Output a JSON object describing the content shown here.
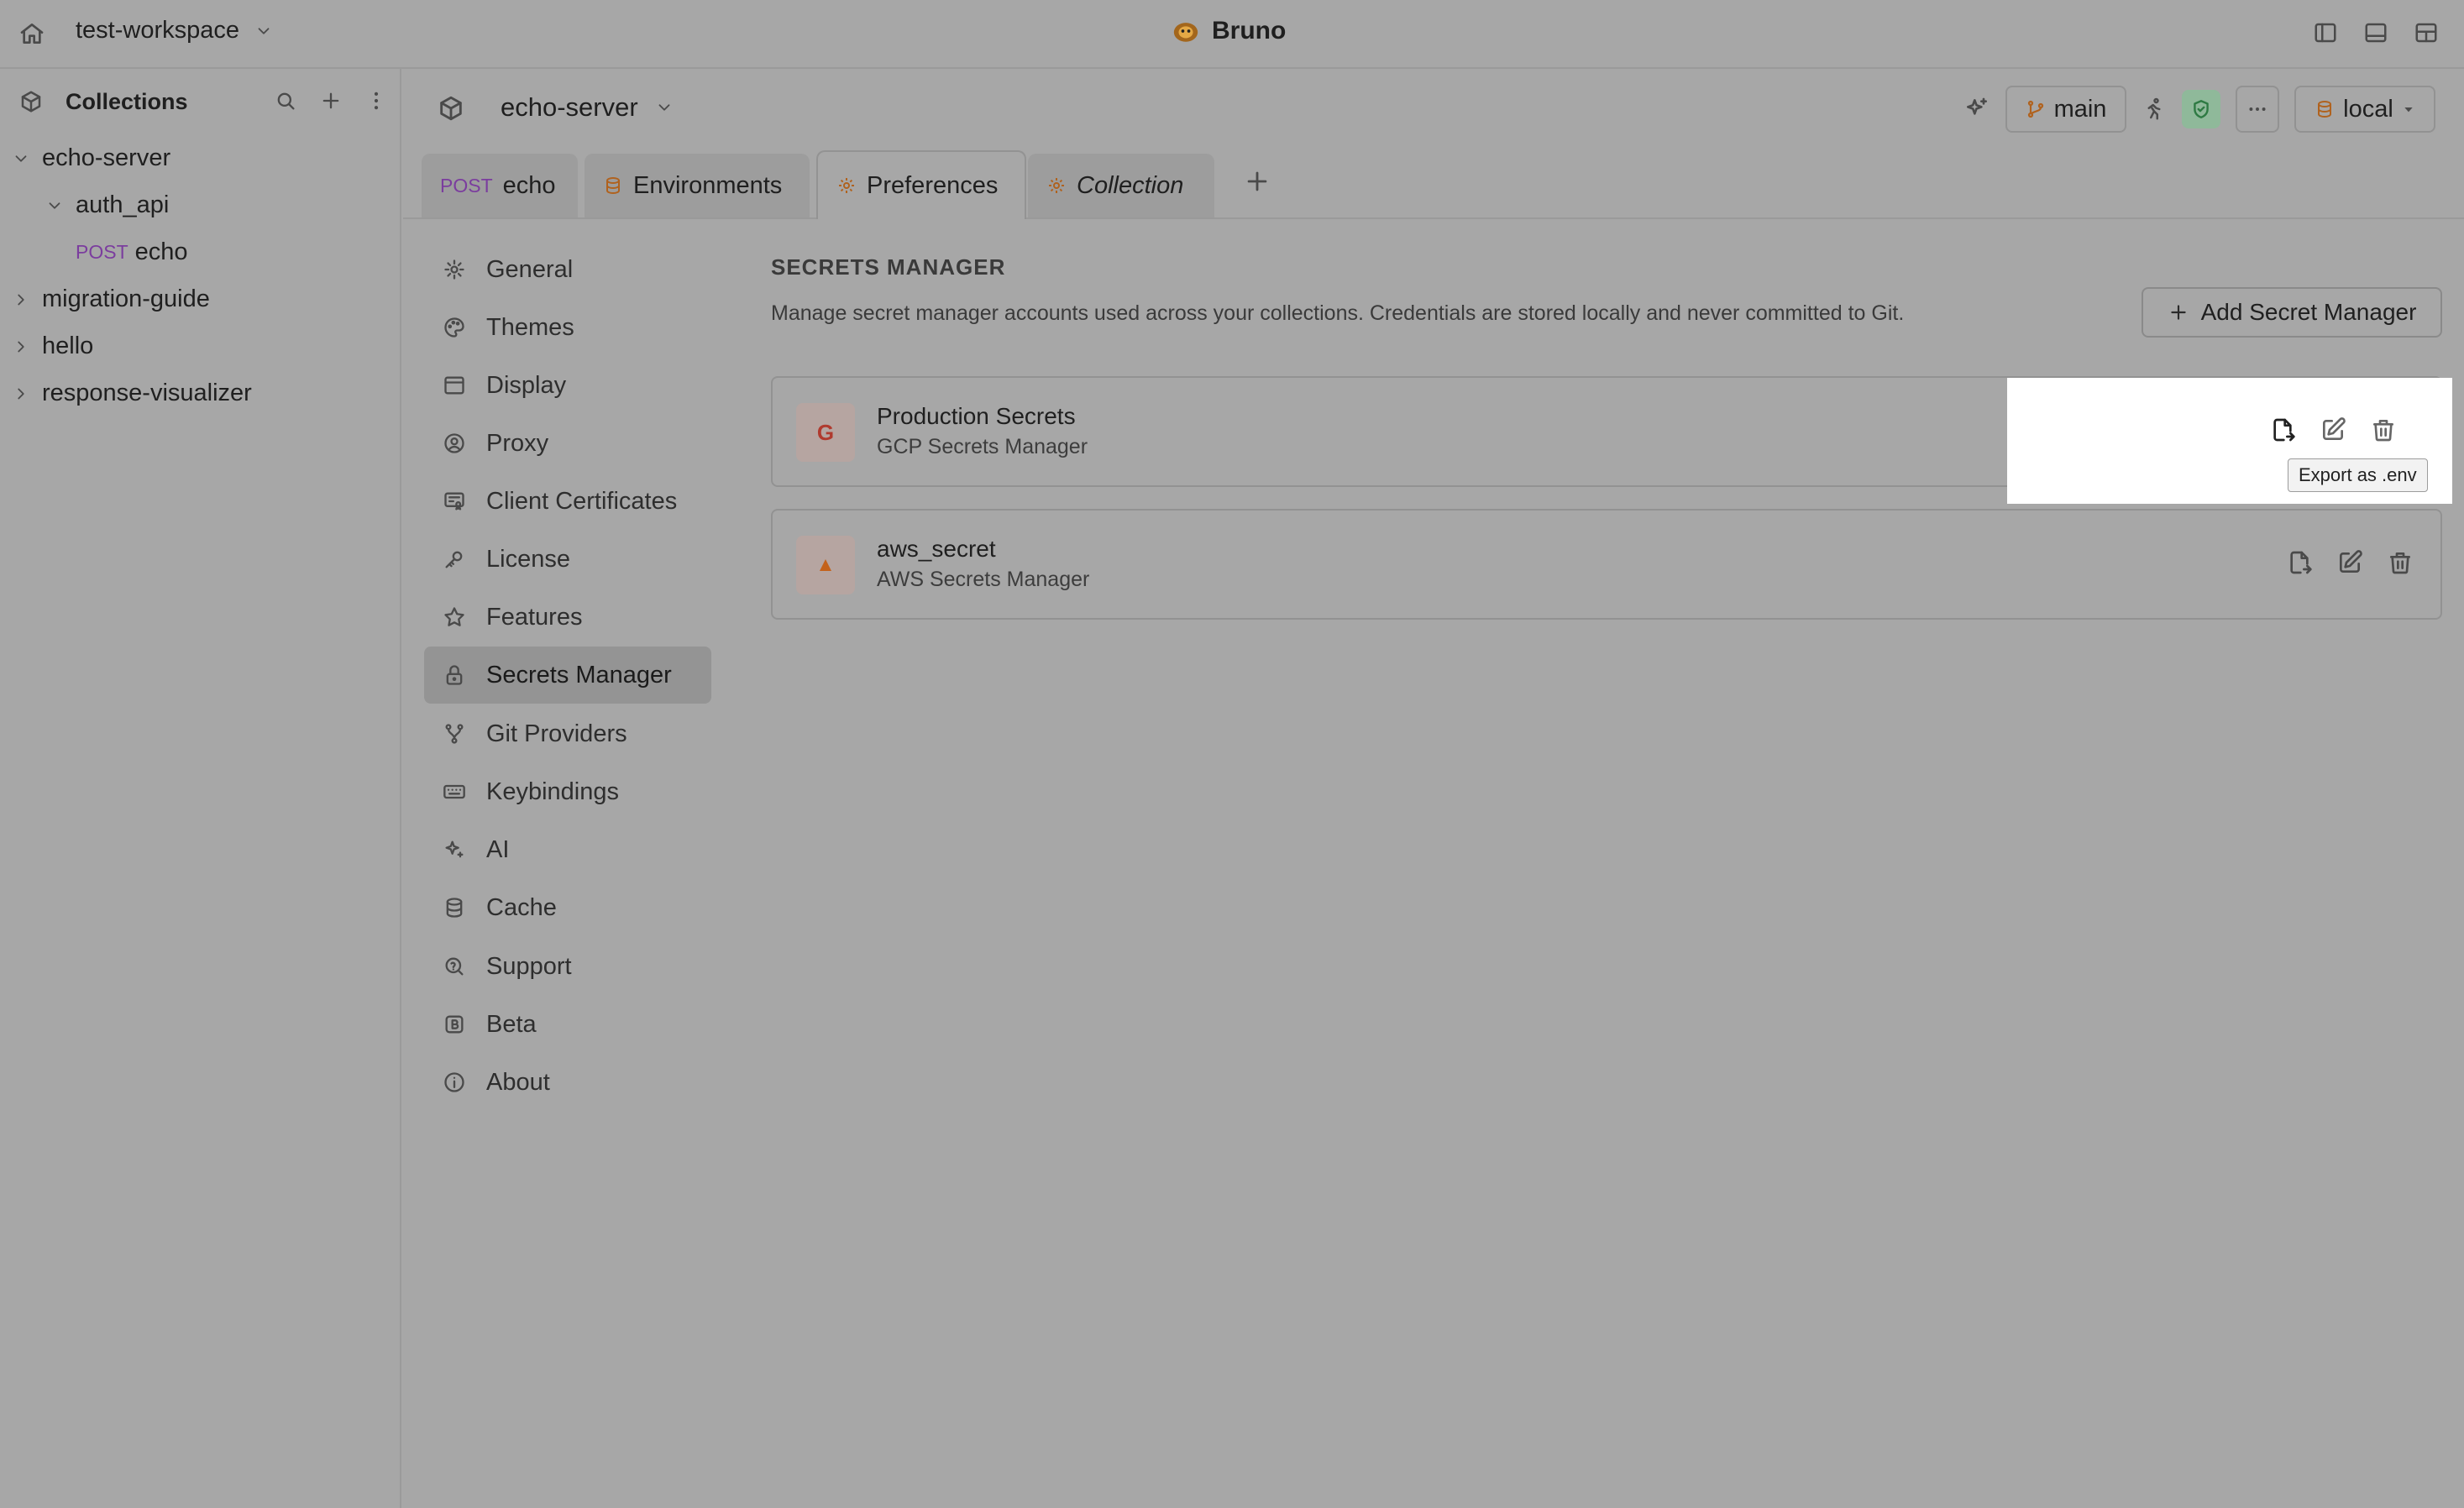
{
  "titlebar": {
    "workspace": "test-workspace",
    "app_name": "Bruno"
  },
  "sidebar": {
    "title": "Collections",
    "tree": [
      {
        "label": "echo-server",
        "expanded": true
      },
      {
        "label": "auth_api",
        "expanded": true
      },
      {
        "method": "POST",
        "label": "echo"
      },
      {
        "label": "migration-guide",
        "expanded": false
      },
      {
        "label": "hello",
        "expanded": false
      },
      {
        "label": "response-visualizer",
        "expanded": false
      }
    ]
  },
  "collection": {
    "name": "echo-server",
    "branch": "main",
    "environment": "local"
  },
  "tabs": [
    {
      "method": "POST",
      "label": "echo"
    },
    {
      "label": "Environments"
    },
    {
      "label": "Preferences"
    },
    {
      "label": "Collection"
    }
  ],
  "prefs_nav": [
    {
      "label": "General",
      "icon": "gear-icon"
    },
    {
      "label": "Themes",
      "icon": "palette-icon"
    },
    {
      "label": "Display",
      "icon": "display-icon"
    },
    {
      "label": "Proxy",
      "icon": "proxy-icon"
    },
    {
      "label": "Client Certificates",
      "icon": "certificate-icon"
    },
    {
      "label": "License",
      "icon": "key-icon"
    },
    {
      "label": "Features",
      "icon": "star-icon"
    },
    {
      "label": "Secrets Manager",
      "icon": "lock-icon",
      "active": true
    },
    {
      "label": "Git Providers",
      "icon": "git-icon"
    },
    {
      "label": "Keybindings",
      "icon": "keyboard-icon"
    },
    {
      "label": "AI",
      "icon": "sparkle-icon"
    },
    {
      "label": "Cache",
      "icon": "database-icon"
    },
    {
      "label": "Support",
      "icon": "support-icon"
    },
    {
      "label": "Beta",
      "icon": "beta-icon"
    },
    {
      "label": "About",
      "icon": "info-icon"
    }
  ],
  "secrets": {
    "title": "SECRETS MANAGER",
    "description": "Manage secret manager accounts used across your collections. Credentials are stored locally and never committed to Git.",
    "add_button": "Add Secret Manager",
    "items": [
      {
        "badge": "G",
        "name": "Production Secrets",
        "type": "GCP Secrets Manager",
        "badge_color": "#b03a2e"
      },
      {
        "badge": "▲",
        "name": "aws_secret",
        "type": "AWS Secrets Manager",
        "badge_color": "#c4621b"
      }
    ],
    "tooltip": "Export as .env"
  }
}
